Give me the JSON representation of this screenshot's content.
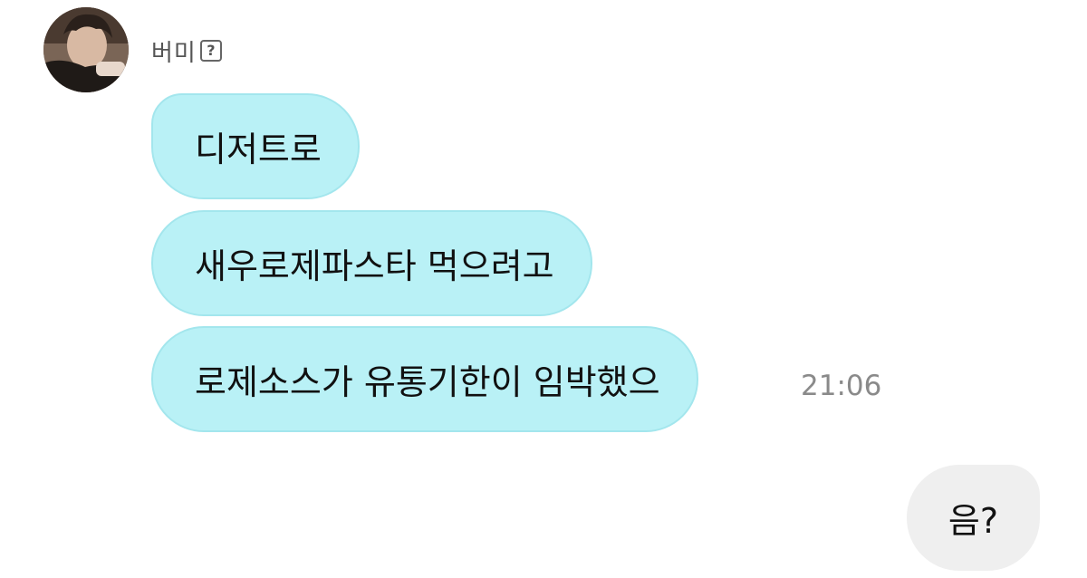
{
  "chat": {
    "sender": {
      "name": "버미",
      "badge": "?",
      "avatar_icon": "profile-photo"
    },
    "incoming": [
      {
        "text": "디저트로"
      },
      {
        "text": "새우로제파스타 먹으려고"
      },
      {
        "text": "로제소스가 유통기한이 임박했으"
      }
    ],
    "last_incoming_time": "21:06",
    "outgoing": [
      {
        "text": "음?"
      }
    ]
  },
  "colors": {
    "incoming_bubble": "#b9f1f6",
    "outgoing_bubble": "#efefef",
    "timestamp": "#8a8a8a"
  }
}
